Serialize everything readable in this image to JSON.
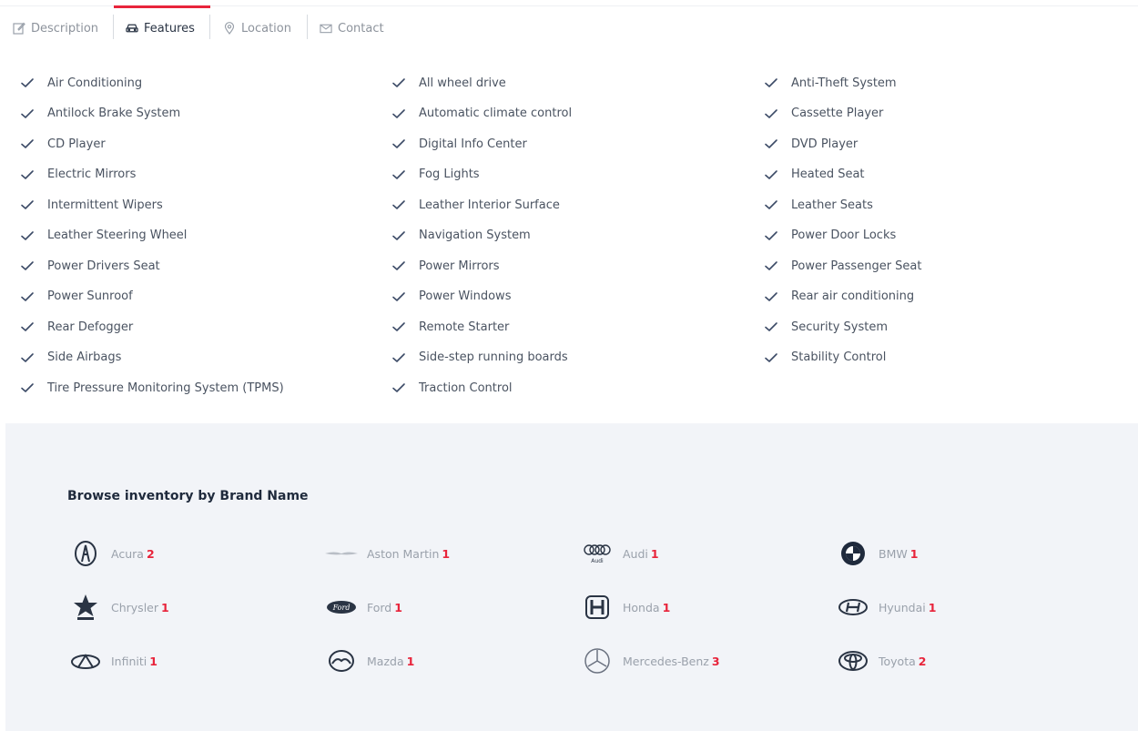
{
  "tabs": [
    {
      "label": "Description",
      "icon": "edit-icon",
      "active": false
    },
    {
      "label": "Features",
      "icon": "car-icon",
      "active": true
    },
    {
      "label": "Location",
      "icon": "location-pin-icon",
      "active": false
    },
    {
      "label": "Contact",
      "icon": "envelope-icon",
      "active": false
    }
  ],
  "features": {
    "icon": "checkmark-icon",
    "columns": [
      [
        "Air Conditioning",
        "Antilock Brake System",
        "CD Player",
        "Electric Mirrors",
        "Intermittent Wipers",
        "Leather Steering Wheel",
        "Power Drivers Seat",
        "Power Sunroof",
        "Rear Defogger",
        "Side Airbags",
        "Tire Pressure Monitoring System (TPMS)"
      ],
      [
        "All wheel drive",
        "Automatic climate control",
        "Digital Info Center",
        "Fog Lights",
        "Leather Interior Surface",
        "Navigation System",
        "Power Mirrors",
        "Power Windows",
        "Remote Starter",
        "Side-step running boards",
        "Traction Control"
      ],
      [
        "Anti-Theft System",
        "Cassette Player",
        "DVD Player",
        "Heated Seat",
        "Leather Seats",
        "Power Door Locks",
        "Power Passenger Seat",
        "Rear air conditioning",
        "Security System",
        "Stability Control"
      ]
    ]
  },
  "brands": {
    "title": "Browse inventory by Brand Name",
    "items": [
      {
        "name": "Acura",
        "count": "2",
        "logo": "acura-logo-icon"
      },
      {
        "name": "Aston Martin",
        "count": "1",
        "logo": "aston-martin-logo-icon"
      },
      {
        "name": "Audi",
        "count": "1",
        "logo": "audi-logo-icon"
      },
      {
        "name": "BMW",
        "count": "1",
        "logo": "bmw-logo-icon"
      },
      {
        "name": "Chrysler",
        "count": "1",
        "logo": "chrysler-logo-icon"
      },
      {
        "name": "Ford",
        "count": "1",
        "logo": "ford-logo-icon"
      },
      {
        "name": "Honda",
        "count": "1",
        "logo": "honda-logo-icon"
      },
      {
        "name": "Hyundai",
        "count": "1",
        "logo": "hyundai-logo-icon"
      },
      {
        "name": "Infiniti",
        "count": "1",
        "logo": "infiniti-logo-icon"
      },
      {
        "name": "Mazda",
        "count": "1",
        "logo": "mazda-logo-icon"
      },
      {
        "name": "Mercedes-Benz",
        "count": "3",
        "logo": "mercedes-benz-logo-icon"
      },
      {
        "name": "Toyota",
        "count": "2",
        "logo": "toyota-logo-icon"
      }
    ]
  },
  "colors": {
    "accent": "#e8243b",
    "section_bg": "#f2f4f8",
    "text": "#4a5361",
    "muted": "#9aa1ab"
  }
}
